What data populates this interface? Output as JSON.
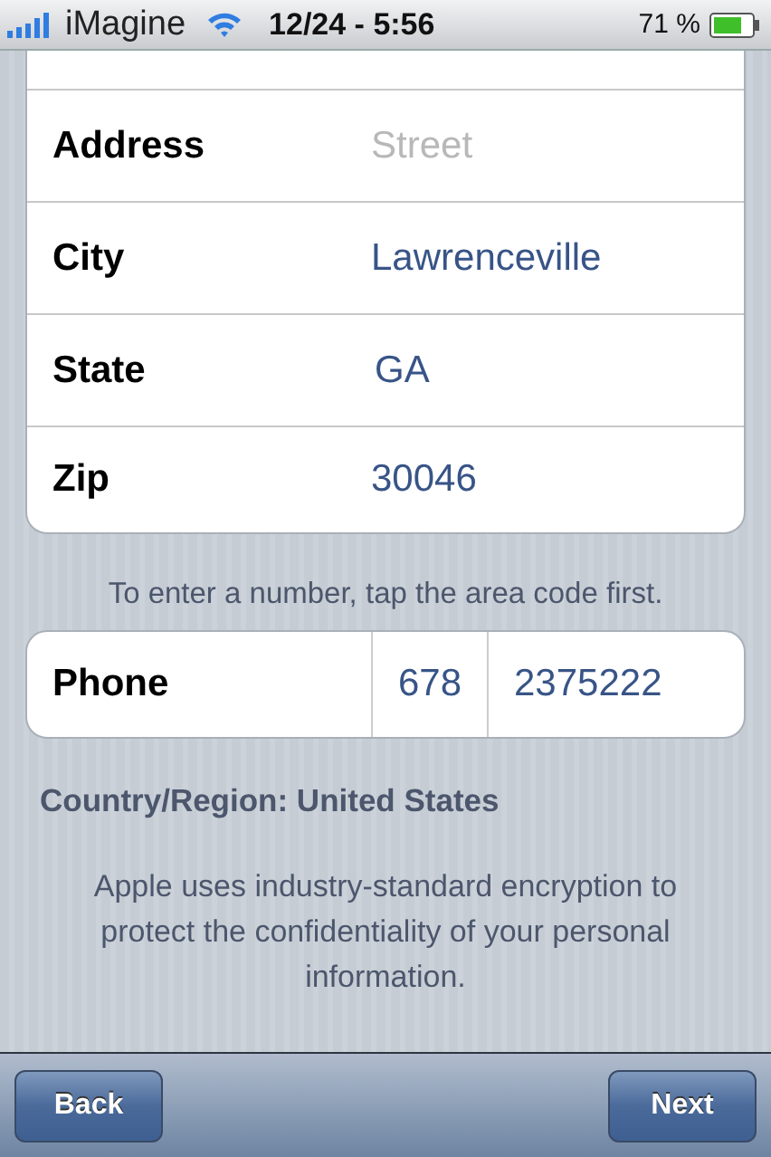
{
  "status_bar": {
    "carrier": "iMagine",
    "time": "12/24 - 5:56",
    "battery": "71 %"
  },
  "address_rows": [
    {
      "label": "Address",
      "placeholder": "Street"
    },
    {
      "label": "City",
      "value": "Lawrenceville"
    },
    {
      "label": "State",
      "value": "GA"
    },
    {
      "label": "Zip",
      "value": "30046"
    }
  ],
  "phone_hint": "To enter a number, tap the area code first.",
  "phone": {
    "label": "Phone",
    "area_code": "678",
    "number": "2375222"
  },
  "country": "Country/Region: United States",
  "privacy_note": "Apple uses industry-standard encryption to protect the confidentiality of your personal information.",
  "toolbar": {
    "buttons": [
      "Back",
      "Next"
    ]
  }
}
